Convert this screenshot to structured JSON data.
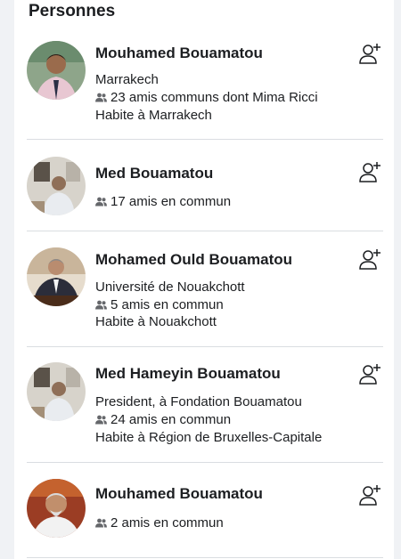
{
  "section_title": "Personnes",
  "people": [
    {
      "name": "Mouhamed Bouamatou",
      "line1": "Marrakech",
      "mutual": "23 amis communs dont Mima Ricci",
      "line3": "Habite à Marrakech"
    },
    {
      "name": "Med Bouamatou",
      "mutual": "17 amis en commun"
    },
    {
      "name": "Mohamed Ould Bouamatou",
      "line1": "Université de Nouakchott",
      "mutual": "5 amis en commun",
      "line3": "Habite à Nouakchott"
    },
    {
      "name": "Med Hameyin Bouamatou",
      "line1": "President, à Fondation Bouamatou",
      "mutual": "24 amis en commun",
      "line3": "Habite à Région de Bruxelles-Capitale"
    },
    {
      "name": "Mouhamed Bouamatou",
      "mutual": "2 amis en commun"
    }
  ],
  "colors": {
    "text": "#1c1e21",
    "icon": "#65676b",
    "divider": "#dadde1"
  }
}
